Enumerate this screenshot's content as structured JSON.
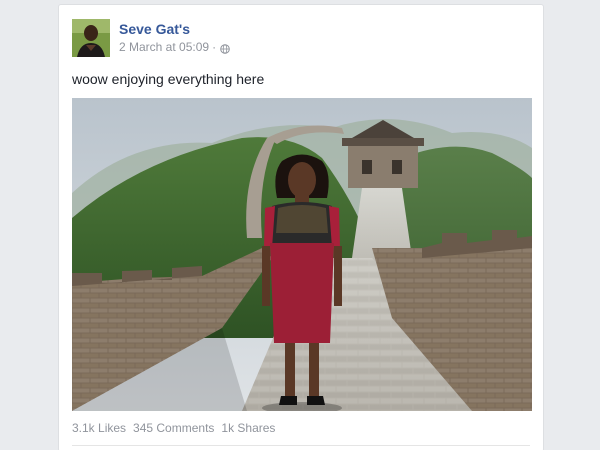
{
  "post": {
    "author": "Seve Gat's",
    "timestamp": "2 March at 05:09",
    "separator": "·",
    "privacy_icon": "globe-icon",
    "text": "woow enjoying everything here",
    "photo_subject": "great-wall-photo"
  },
  "stats": {
    "likes": "3.1k Likes",
    "comments": "345 Comments",
    "shares": "1k Shares"
  },
  "colors": {
    "author_link": "#365899",
    "meta_text": "#90949c",
    "body_text": "#1d2129",
    "page_bg": "#e9ebee"
  }
}
